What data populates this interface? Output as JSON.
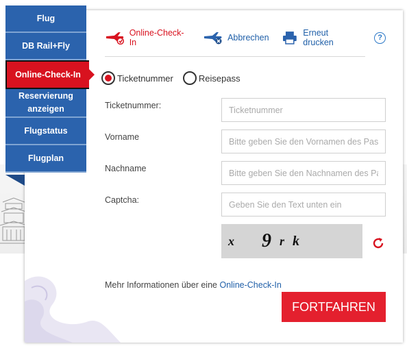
{
  "sidebar": {
    "items": [
      {
        "label": "Flug"
      },
      {
        "label": "DB Rail+Fly"
      },
      {
        "label": "Online-Check-In"
      },
      {
        "label": "Reservierung anzeigen"
      },
      {
        "label": "Flugstatus"
      },
      {
        "label": "Flugplan"
      }
    ],
    "active_index": 2
  },
  "toolbar": {
    "checkin_label": "Online-Check-In",
    "cancel_label": "Abbrechen",
    "reprint_label": "Erneut drucken",
    "help_label": "?"
  },
  "radios": {
    "ticket_label": "Ticketnummer",
    "passport_label": "Reisepass",
    "selected": "Ticketnummer"
  },
  "form": {
    "ticket": {
      "label": "Ticketnummer:",
      "placeholder": "Ticketnummer"
    },
    "firstname": {
      "label": "Vorname",
      "placeholder": "Bitte geben Sie den Vornamen des Passagiers ein"
    },
    "lastname": {
      "label": "Nachname",
      "placeholder": "Bitte geben Sie den Nachnamen des Passagiers ein"
    },
    "captcha": {
      "label": "Captcha:",
      "placeholder": "Geben Sie den Text unten ein"
    }
  },
  "captcha_chars": [
    "x",
    "9",
    "r",
    "k"
  ],
  "info": {
    "prefix": "Mehr Informationen über eine ",
    "link": "Online-Check-In"
  },
  "submit_label": "FORTFAHREN",
  "colors": {
    "primary_blue": "#2b63ad",
    "accent_red": "#d8121f",
    "button_red": "#e4202e",
    "link_blue": "#1f5fa8"
  },
  "icons": {
    "checkin": "plane-checkin-icon",
    "cancel": "plane-cancel-icon",
    "reprint": "printer-icon",
    "help": "help-icon",
    "refresh": "refresh-icon"
  }
}
